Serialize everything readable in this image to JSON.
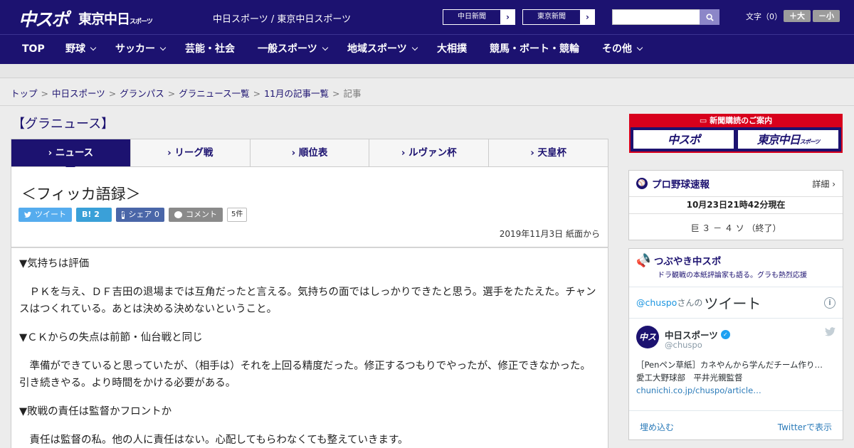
{
  "header": {
    "logo_chuspo": "中スポ",
    "logo_tokyo": "東京中日",
    "logo_tokyo_small": "スポーツ",
    "site_title": "中日スポーツ / 東京中日スポーツ",
    "link_chunichi": "中日新聞",
    "link_tokyo": "東京新聞",
    "search_placeholder": "",
    "font_size_label": "文字（0）",
    "font_larger": "＋大",
    "font_smaller": "－小"
  },
  "nav": {
    "items": [
      {
        "label": "TOP",
        "has_menu": false
      },
      {
        "label": "野球",
        "has_menu": true
      },
      {
        "label": "サッカー",
        "has_menu": true
      },
      {
        "label": "芸能・社会",
        "has_menu": false
      },
      {
        "label": "一般スポーツ",
        "has_menu": true
      },
      {
        "label": "地域スポーツ",
        "has_menu": true
      },
      {
        "label": "大相撲",
        "has_menu": false
      },
      {
        "label": "競馬・ボート・競輪",
        "has_menu": false
      },
      {
        "label": "その他",
        "has_menu": true
      }
    ]
  },
  "breadcrumb": {
    "items": [
      "トップ",
      "中日スポーツ",
      "グランパス",
      "グラニュース一覧",
      "11月の記事一覧"
    ],
    "current": "記事",
    "separator": ">"
  },
  "main": {
    "section_title": "【グラニュース】",
    "tabs": [
      {
        "label": "› ニュース",
        "active": true
      },
      {
        "label": "› リーグ戦",
        "active": false
      },
      {
        "label": "› 順位表",
        "active": false
      },
      {
        "label": "› ルヴァン杯",
        "active": false
      },
      {
        "label": "› 天皇杯",
        "active": false
      }
    ],
    "article_title": "＜フィッカ語録＞",
    "share": {
      "tweet": "ツイート",
      "hatena": "B! 2",
      "facebook": "シェア 0",
      "comment": "コメント",
      "comment_count": "5件"
    },
    "date": "2019年11月3日 紙面から",
    "body": [
      {
        "q": "▼気持ちは評価",
        "a": "ＰＫを与え、ＤＦ吉田の退場までは互角だったと言える。気持ちの面ではしっかりできたと思う。選手をたたえた。チャンスはつくれている。あとは決める決めないということ。"
      },
      {
        "q": "▼ＣＫからの失点は前節・仙台戦と同じ",
        "a": "準備ができていると思っていたが、（相手は）それを上回る精度だった。修正するつもりでやったが、修正できなかった。引き続きやる。より時間をかける必要がある。"
      },
      {
        "q": "▼敗戦の責任は監督かフロントか",
        "a": "責任は監督の私。他の人に責任はない。心配してもらわなくても整えていきます。"
      }
    ]
  },
  "sidebar": {
    "subscription_title": "新聞購読のご案内",
    "subscription_logo_1": "中スポ",
    "subscription_logo_2": "東京中日",
    "subscription_logo_2_small": "スポーツ",
    "baseball": {
      "title": "プロ野球速報",
      "more": "詳細 ›",
      "updated": "10月23日21時42分現在",
      "score": "巨 ３ － ４ ソ （終了）"
    },
    "tweets": {
      "title": "つぶやき中スポ",
      "subtitle": "ドラ観戦の本紙評論家も語る。グラも熱烈応援",
      "widget_handle": "@chuspo",
      "widget_san": "さんの",
      "widget_label": "ツイート",
      "account_name": "中日スポーツ",
      "account_handle": "@chuspo",
      "tweet_text": "［Penペン草紙］カネやんから学んだチーム作り…　愛工大野球部　平井光親監督",
      "tweet_link": "chunichi.co.jp/chuspo/article…",
      "embed": "埋め込む",
      "view_on_twitter": "Twitterで表示"
    }
  },
  "colors": {
    "brand": "#1c1270",
    "accent_red": "#d8001c"
  }
}
